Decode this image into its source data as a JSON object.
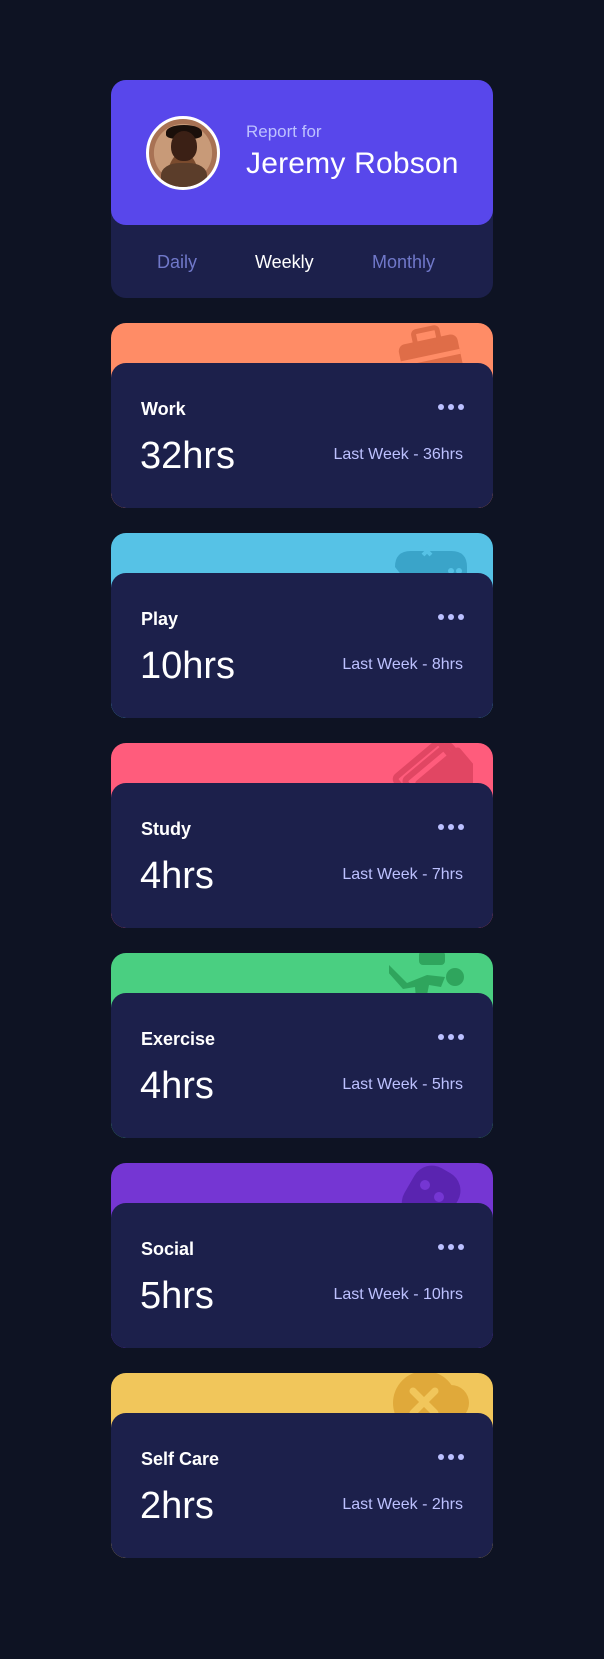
{
  "profile": {
    "report_label": "Report for",
    "name": "Jeremy Robson"
  },
  "tabs": [
    {
      "label": "Daily",
      "active": false
    },
    {
      "label": "Weekly",
      "active": true
    },
    {
      "label": "Monthly",
      "active": false
    }
  ],
  "activities": [
    {
      "title": "Work",
      "hours": "32hrs",
      "last_week": "Last Week - 36hrs",
      "color": "#ff8c66",
      "icon": "briefcase-icon"
    },
    {
      "title": "Play",
      "hours": "10hrs",
      "last_week": "Last Week - 8hrs",
      "color": "#56c2e6",
      "icon": "gamepad-icon"
    },
    {
      "title": "Study",
      "hours": "4hrs",
      "last_week": "Last Week - 7hrs",
      "color": "#ff5c7c",
      "icon": "book-icon"
    },
    {
      "title": "Exercise",
      "hours": "4hrs",
      "last_week": "Last Week - 5hrs",
      "color": "#4acf81",
      "icon": "running-icon"
    },
    {
      "title": "Social",
      "hours": "5hrs",
      "last_week": "Last Week - 10hrs",
      "color": "#7536d3",
      "icon": "chat-icon"
    },
    {
      "title": "Self Care",
      "hours": "2hrs",
      "last_week": "Last Week - 2hrs",
      "color": "#f1c65b",
      "icon": "heart-icon"
    }
  ],
  "colors": {
    "page_bg": "#0e1323",
    "card_bg": "#1c204b",
    "profile_bg": "#5847eb",
    "muted_text": "#bdc1ff",
    "tab_inactive": "#7078c9"
  }
}
